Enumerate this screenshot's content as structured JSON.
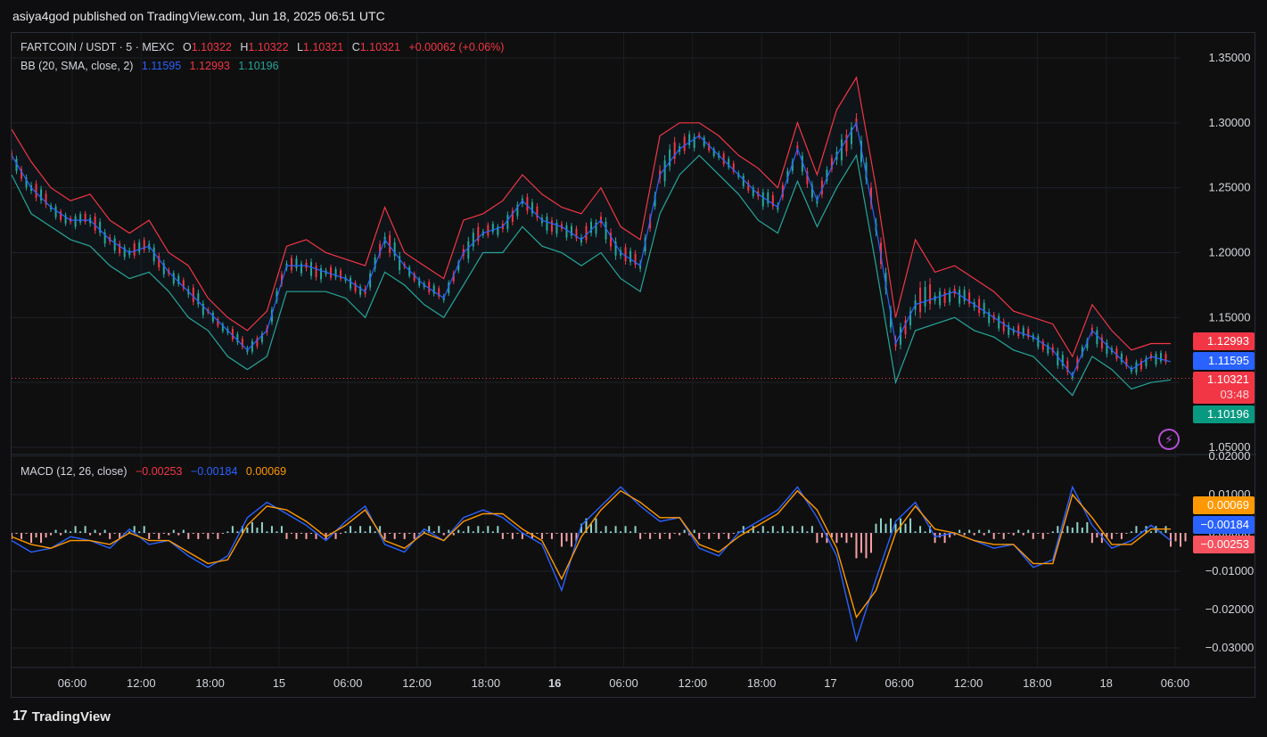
{
  "header": {
    "publisher": "asiya4god published on TradingView.com, Jun 18, 2025 06:51 UTC"
  },
  "legend": {
    "symbol": "FARTCOIN / USDT · 5 · MEXC",
    "o_label": "O",
    "o": "1.10322",
    "h_label": "H",
    "h": "1.10322",
    "l_label": "L",
    "l": "1.10321",
    "c_label": "C",
    "c": "1.10321",
    "change": "+0.00062 (+0.06%)",
    "bb_label": "BB (20, SMA, close, 2)",
    "bb_mid": "1.11595",
    "bb_upper": "1.12993",
    "bb_lower": "1.10196",
    "macd_label": "MACD (12, 26, close)",
    "macd_hist": "−0.00253",
    "macd_macd": "−0.00184",
    "macd_signal": "0.00069"
  },
  "price_tags": {
    "upper": "1.12993",
    "mid": "1.11595",
    "last": "1.10321",
    "countdown": "03:48",
    "lower": "1.10196"
  },
  "macd_tags": {
    "signal": "0.00069",
    "macd": "−0.00184",
    "hist": "−0.00253"
  },
  "colors": {
    "bb_upper": "#f23645",
    "bb_mid": "#2962ff",
    "bb_lower": "#26a69a",
    "up": "#26a69a",
    "down": "#f23645",
    "macd_line": "#2962ff",
    "signal_line": "#ff9800",
    "hist_pos": "#8fd3c9",
    "hist_neg": "#f7a1a8"
  },
  "footer": {
    "brand": "TradingView"
  },
  "chart_data": [
    {
      "type": "line",
      "title": "",
      "y_axis_ticks": [
        "1.35000",
        "1.30000",
        "1.25000",
        "1.20000",
        "1.15000",
        "1.10000",
        "1.05000"
      ],
      "ylim": [
        1.05,
        1.35
      ],
      "x_ticks": [
        "06:00",
        "12:00",
        "18:00",
        "15",
        "06:00",
        "12:00",
        "18:00",
        "16",
        "06:00",
        "12:00",
        "18:00",
        "17",
        "06:00",
        "12:00",
        "18:00",
        "18",
        "06:00"
      ],
      "series": [
        {
          "name": "",
          "role": "upper",
          "values": [
            1.295,
            1.27,
            1.25,
            1.24,
            1.245,
            1.225,
            1.215,
            1.225,
            1.2,
            1.19,
            1.165,
            1.15,
            1.14,
            1.155,
            1.205,
            1.21,
            1.2,
            1.195,
            1.19,
            1.235,
            1.2,
            1.19,
            1.18,
            1.225,
            1.23,
            1.24,
            1.26,
            1.245,
            1.235,
            1.23,
            1.25,
            1.22,
            1.21,
            1.29,
            1.3,
            1.3,
            1.29,
            1.275,
            1.265,
            1.25,
            1.3,
            1.26,
            1.31,
            1.335,
            1.25,
            1.15,
            1.21,
            1.185,
            1.19,
            1.18,
            1.17,
            1.155,
            1.15,
            1.145,
            1.12,
            1.16,
            1.14,
            1.125,
            1.13,
            1.13
          ]
        },
        {
          "name": "",
          "role": "basis",
          "values": [
            1.275,
            1.25,
            1.235,
            1.225,
            1.225,
            1.21,
            1.2,
            1.205,
            1.185,
            1.17,
            1.155,
            1.14,
            1.125,
            1.14,
            1.19,
            1.19,
            1.185,
            1.18,
            1.17,
            1.21,
            1.19,
            1.175,
            1.165,
            1.2,
            1.215,
            1.22,
            1.24,
            1.225,
            1.22,
            1.21,
            1.225,
            1.2,
            1.19,
            1.26,
            1.28,
            1.29,
            1.275,
            1.26,
            1.245,
            1.235,
            1.28,
            1.24,
            1.275,
            1.3,
            1.22,
            1.13,
            1.16,
            1.165,
            1.17,
            1.16,
            1.15,
            1.14,
            1.135,
            1.125,
            1.105,
            1.14,
            1.125,
            1.11,
            1.12,
            1.116
          ]
        },
        {
          "name": "",
          "role": "lower",
          "values": [
            1.26,
            1.23,
            1.22,
            1.21,
            1.205,
            1.19,
            1.18,
            1.185,
            1.17,
            1.15,
            1.14,
            1.12,
            1.11,
            1.12,
            1.17,
            1.17,
            1.17,
            1.165,
            1.15,
            1.185,
            1.175,
            1.16,
            1.15,
            1.175,
            1.2,
            1.2,
            1.22,
            1.205,
            1.2,
            1.19,
            1.2,
            1.18,
            1.17,
            1.23,
            1.26,
            1.275,
            1.26,
            1.245,
            1.225,
            1.215,
            1.255,
            1.22,
            1.25,
            1.275,
            1.19,
            1.1,
            1.14,
            1.145,
            1.15,
            1.14,
            1.135,
            1.125,
            1.12,
            1.105,
            1.09,
            1.12,
            1.11,
            1.095,
            1.1,
            1.102
          ]
        }
      ]
    },
    {
      "type": "line",
      "title": "",
      "y_axis_ticks": [
        "0.02000",
        "0.01000",
        "0.00000",
        "−0.01000",
        "−0.02000",
        "−0.03000"
      ],
      "ylim": [
        -0.03,
        0.02
      ],
      "series": [
        {
          "name": "",
          "role": "macd",
          "values": [
            -0.002,
            -0.005,
            -0.004,
            -0.001,
            -0.002,
            -0.004,
            0.001,
            -0.003,
            -0.002,
            -0.006,
            -0.009,
            -0.006,
            0.004,
            0.008,
            0.005,
            0.002,
            -0.002,
            0.003,
            0.007,
            -0.003,
            -0.005,
            0.001,
            -0.002,
            0.004,
            0.006,
            0.004,
            0.0,
            -0.003,
            -0.015,
            0.002,
            0.007,
            0.012,
            0.007,
            0.003,
            0.004,
            -0.004,
            -0.006,
            0.0,
            0.003,
            0.006,
            0.012,
            0.004,
            -0.006,
            -0.028,
            -0.012,
            0.003,
            0.008,
            -0.001,
            0.0,
            -0.002,
            -0.004,
            -0.003,
            -0.009,
            -0.007,
            0.012,
            0.002,
            -0.004,
            -0.002,
            0.002,
            -0.002
          ]
        },
        {
          "name": "",
          "role": "signal",
          "values": [
            -0.001,
            -0.003,
            -0.004,
            -0.002,
            -0.002,
            -0.003,
            0.0,
            -0.002,
            -0.002,
            -0.005,
            -0.008,
            -0.007,
            0.002,
            0.007,
            0.006,
            0.003,
            -0.001,
            0.002,
            0.006,
            -0.002,
            -0.004,
            0.0,
            -0.002,
            0.003,
            0.005,
            0.005,
            0.001,
            -0.002,
            -0.012,
            -0.001,
            0.006,
            0.011,
            0.008,
            0.004,
            0.004,
            -0.003,
            -0.005,
            -0.001,
            0.002,
            0.005,
            0.011,
            0.006,
            -0.004,
            -0.022,
            -0.015,
            0.0,
            0.007,
            0.001,
            0.0,
            -0.002,
            -0.003,
            -0.003,
            -0.008,
            -0.008,
            0.01,
            0.004,
            -0.003,
            -0.003,
            0.001,
            0.001
          ]
        }
      ]
    }
  ]
}
